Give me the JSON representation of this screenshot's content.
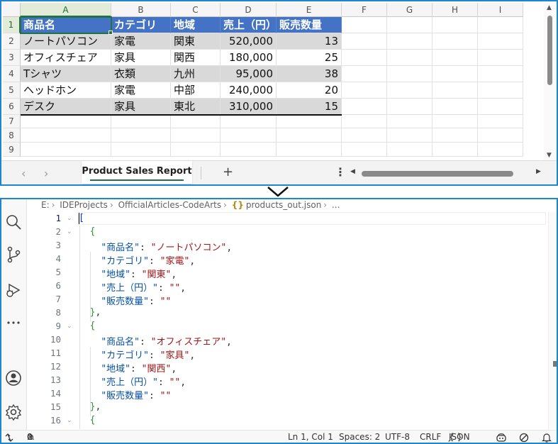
{
  "spreadsheet": {
    "columns": [
      "A",
      "B",
      "C",
      "D",
      "E",
      "F",
      "G",
      "H",
      "I"
    ],
    "rows": [
      "1",
      "2",
      "3",
      "4",
      "5",
      "6",
      "7",
      "8",
      "9"
    ],
    "headers": [
      "商品名",
      "カテゴリ",
      "地域",
      "売上（円）",
      "販売数量"
    ],
    "data": [
      [
        "ノートパソコン",
        "家電",
        "関東",
        "520,000",
        "13"
      ],
      [
        "オフィスチェア",
        "家具",
        "関西",
        "180,000",
        "25"
      ],
      [
        "Tシャツ",
        "衣類",
        "九州",
        "95,000",
        "38"
      ],
      [
        "ヘッドホン",
        "家電",
        "中部",
        "240,000",
        "20"
      ],
      [
        "デスク",
        "家具",
        "東北",
        "310,000",
        "15"
      ]
    ],
    "sheet_tab": "Product Sales Report",
    "add_sheet": "+",
    "more": "⋮",
    "colors": {
      "header_fill": "#4472c4",
      "band_fill": "#d9d9d9",
      "selection": "#217346"
    }
  },
  "vscode": {
    "breadcrumb": [
      "E:",
      "IDEProjects",
      "OfficialArticles-CodeArts",
      "products_out.json",
      "..."
    ],
    "breadcrumb_icon": "{}",
    "line_numbers": [
      "1",
      "2",
      "3",
      "4",
      "5",
      "6",
      "7",
      "8",
      "9",
      "10",
      "11",
      "12",
      "13",
      "14",
      "15",
      "16"
    ],
    "keys": [
      "商品名",
      "カテゴリ",
      "地域",
      "売上（円）",
      "販売数量"
    ],
    "records": [
      [
        "ノートパソコン",
        "家電",
        "関東",
        "",
        ""
      ],
      [
        "オフィスチェア",
        "家具",
        "関西",
        "",
        ""
      ]
    ],
    "status": {
      "errors": "0",
      "warnings": "0",
      "position": "Ln 1, Col 1",
      "spaces": "Spaces: 2",
      "encoding": "UTF-8",
      "eol": "CRLF",
      "language_icon": "{ }",
      "language": "JSON"
    }
  }
}
